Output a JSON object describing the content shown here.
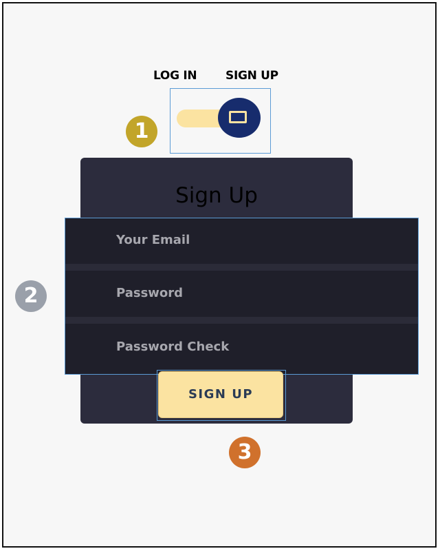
{
  "tabs": {
    "login_label": "LOG IN",
    "signup_label": "SIGN UP"
  },
  "toggle": {
    "state": "sign-up",
    "knob_icon": "rectangle-icon"
  },
  "badges": {
    "one": "1",
    "two": "2",
    "three": "3"
  },
  "form": {
    "title": "Sign Up",
    "fields": [
      {
        "placeholder": "Your Email"
      },
      {
        "placeholder": "Password"
      },
      {
        "placeholder": "Password Check"
      }
    ],
    "submit_label": "SIGN UP"
  },
  "colors": {
    "accent_yellow": "#fbe3a1",
    "knob_navy": "#172c6d",
    "card_dark": "#2c2c3d",
    "fields_dark": "#1f1f2a",
    "highlight_blue": "#5b9bd5",
    "badge_gold": "#c2a52a",
    "badge_gray": "#9aa0aa",
    "badge_orange": "#d0712c"
  }
}
